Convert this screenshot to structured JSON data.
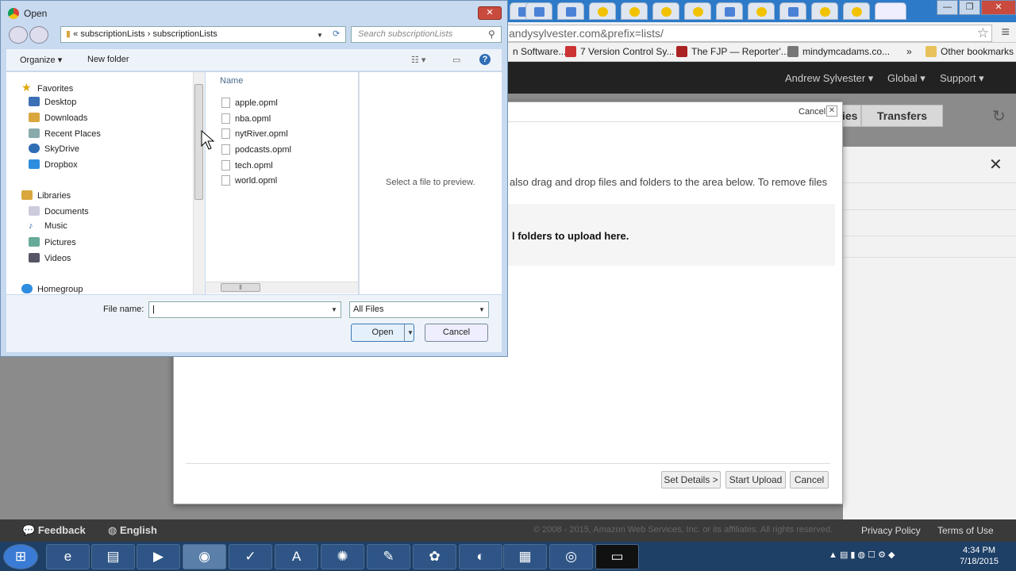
{
  "browser": {
    "url_text": "andysylvester.com&prefix=lists/",
    "bookmarks": [
      "n Software...",
      "7 Version Control Sy...",
      "The FJP — Reporter'...",
      "mindymcadams.co...",
      "»",
      "Other bookmarks"
    ]
  },
  "aws": {
    "user_menu": "Andrew Sylvester",
    "region_menu": "Global",
    "support_menu": "Support",
    "partial_tab": "ies",
    "transfers_tab": "Transfers",
    "modal": {
      "cancel_link": "Cancel",
      "description": "also drag and drop files and folders to the area below. To remove files",
      "drop_text": "l folders to upload here.",
      "set_details_button": "Set Details >",
      "start_upload_button": "Start Upload",
      "cancel_button": "Cancel"
    },
    "footer": {
      "feedback": "Feedback",
      "language": "English",
      "copyright": "© 2008 - 2015, Amazon Web Services, Inc. or its affiliates. All rights reserved.",
      "privacy": "Privacy Policy",
      "terms": "Terms of Use"
    }
  },
  "dialog": {
    "title": "Open",
    "path": [
      "«",
      "subscriptionLists",
      "›",
      "subscriptionLists"
    ],
    "search_placeholder": "Search subscriptionLists",
    "organize": "Organize",
    "new_folder": "New folder",
    "nav": {
      "favorites": "Favorites",
      "desktop": "Desktop",
      "downloads": "Downloads",
      "recent": "Recent Places",
      "skydrive": "SkyDrive",
      "dropbox": "Dropbox",
      "libraries": "Libraries",
      "documents": "Documents",
      "music": "Music",
      "pictures": "Pictures",
      "videos": "Videos",
      "homegroup": "Homegroup"
    },
    "column_name": "Name",
    "files": [
      "apple.opml",
      "nba.opml",
      "nytRiver.opml",
      "podcasts.opml",
      "tech.opml",
      "world.opml"
    ],
    "preview_text": "Select a file to preview.",
    "file_name_label": "File name:",
    "file_name_value": "",
    "filter": "All Files",
    "open_button": "Open",
    "cancel_button": "Cancel"
  },
  "taskbar": {
    "time": "4:34 PM",
    "date": "7/18/2015"
  }
}
